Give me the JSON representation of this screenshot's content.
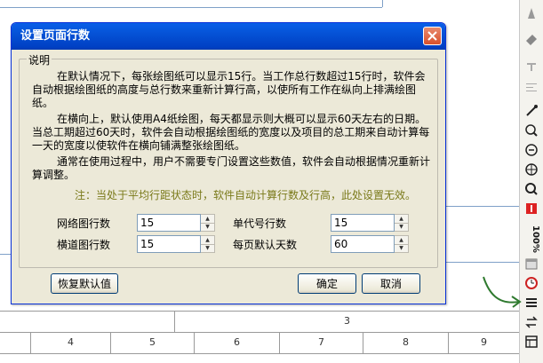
{
  "dialog": {
    "title": "设置页面行数",
    "group_label": "说明",
    "paragraphs": [
      "在默认情况下，每张绘图纸可以显示15行。当工作总行数超过15行时，软件会自动根据绘图纸的高度与总行数来重新计算行高，以使所有工作在纵向上排满绘图纸。",
      "在横向上，默认使用A4纸绘图，每天都显示则大概可以显示60天左右的日期。当总工期超过60天时，软件会自动根据绘图纸的宽度以及项目的总工期来自动计算每一天的宽度以使软件在横向铺满整张绘图纸。",
      "通常在使用过程中，用户不需要专门设置这些数值，软件会自动根据情况重新计算调整。"
    ],
    "note": "注：当处于平均行距状态时，软件自动计算行数及行高，此处设置无效。",
    "fields": {
      "network_rows": {
        "label": "网络图行数",
        "value": "15"
      },
      "single_rows": {
        "label": "单代号行数",
        "value": "15"
      },
      "bar_rows": {
        "label": "横道图行数",
        "value": "15"
      },
      "days_per_page": {
        "label": "每页默认天数",
        "value": "60"
      }
    },
    "buttons": {
      "restore_defaults": "恢复默认值",
      "ok": "确定",
      "cancel": "取消"
    }
  },
  "ruler": {
    "top_label": "3",
    "columns": [
      "4",
      "5",
      "6",
      "7",
      "8",
      "9"
    ]
  },
  "toolbar": {
    "zoom_text": "100%"
  },
  "colors": {
    "titlebar": "#0552d6",
    "dialog_bg": "#ece9d8",
    "note": "#7a7a1a",
    "close_button": "#d8502c",
    "annotation": "#2f7a2f"
  }
}
